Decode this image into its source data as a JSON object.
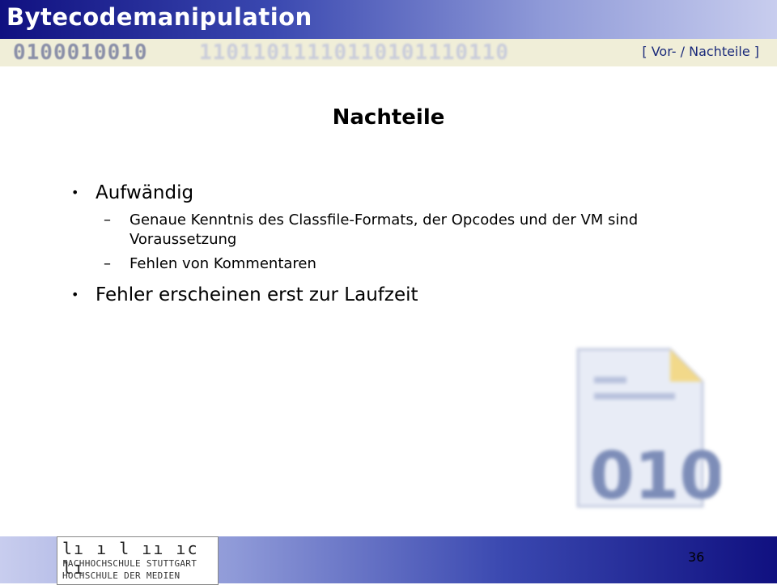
{
  "header": {
    "title": "Bytecodemanipulation",
    "binary_dark": "0100010010",
    "binary_light": "11011011110110101110110",
    "section": "[ Vor- / Nachteile ]"
  },
  "slide": {
    "title": "Nachteile",
    "bullets": [
      {
        "text": "Aufwändig",
        "sub": [
          "Genaue Kenntnis des Classfile-Formats, der Opcodes und der VM sind Voraussetzung",
          "Fehlen von Kommentaren"
        ]
      },
      {
        "text": "Fehler erscheinen erst zur Laufzeit",
        "sub": []
      }
    ],
    "bullet_glyph": "•",
    "dash_glyph": "–"
  },
  "illustration": {
    "icon": "binary-document-icon",
    "text": "010"
  },
  "footer": {
    "logo_marks": "lı ı l ıı ıc lı",
    "logo_line1": "FACHHOCHSCHULE STUTTGART",
    "logo_line2": "HOCHSCHULE DER MEDIEN",
    "page_number": "36"
  },
  "colors": {
    "header_dark": "#101080",
    "header_light": "#c8cdee",
    "binary_bar": "#f0eed8",
    "section_label": "#1a2a7a"
  }
}
